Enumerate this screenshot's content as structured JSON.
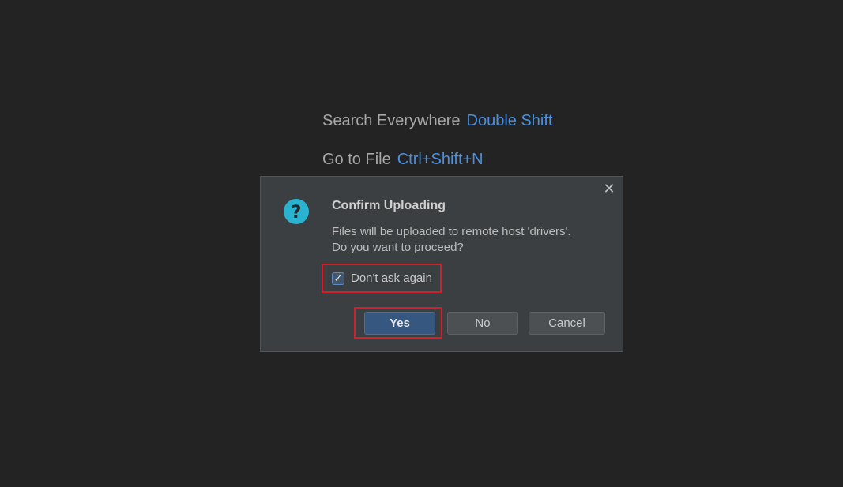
{
  "hints": {
    "search_label": "Search Everywhere",
    "search_shortcut": "Double Shift",
    "goto_label": "Go to File",
    "goto_shortcut": "Ctrl+Shift+N"
  },
  "dialog": {
    "title": "Confirm Uploading",
    "message_line1": "Files will be uploaded to remote host 'drivers'.",
    "message_line2": "Do you want to proceed?",
    "checkbox_label": "Don't ask again",
    "checkbox_checked": true,
    "close_icon": "close-icon",
    "question_icon": "question-icon",
    "buttons": {
      "yes": "Yes",
      "no": "No",
      "cancel": "Cancel"
    }
  },
  "colors": {
    "background": "#232323",
    "dialog_bg": "#3c3f41",
    "shortcut": "#4a8fe0",
    "question_icon": "#29b3d1",
    "highlight": "#d0202a",
    "yes_button": "#365880"
  }
}
